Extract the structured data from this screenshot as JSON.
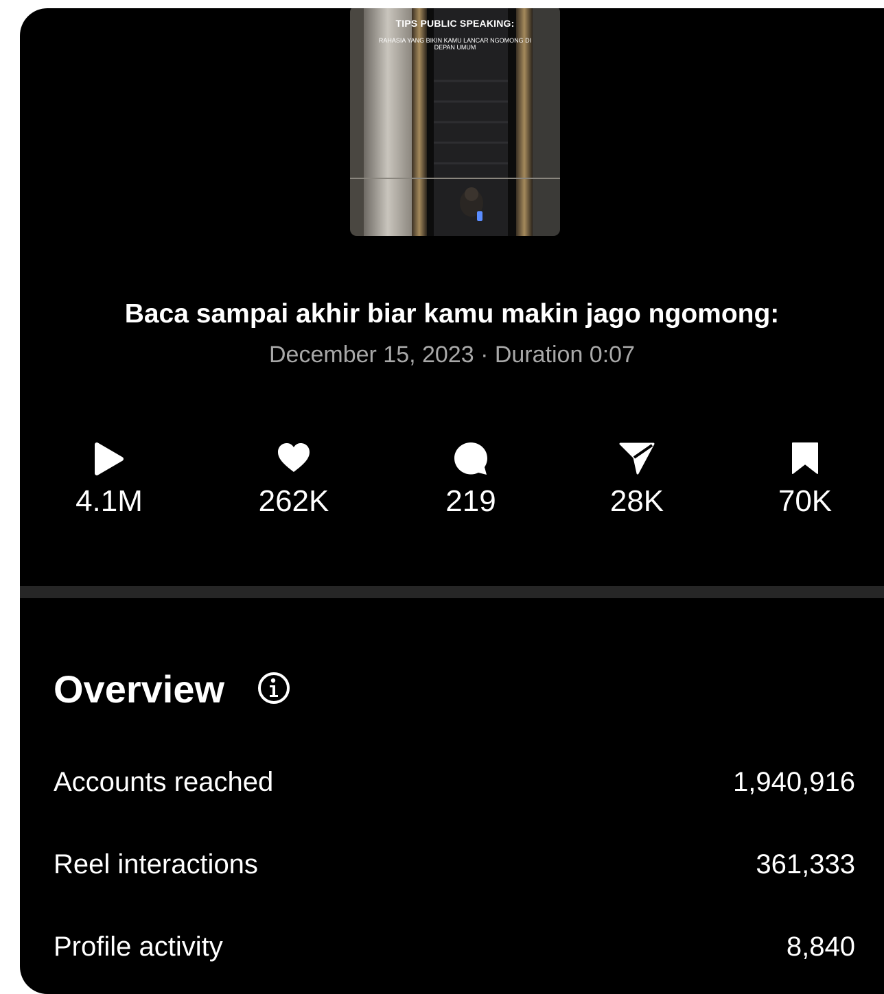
{
  "reel": {
    "thumbnail": {
      "title": "TIPS PUBLIC SPEAKING:",
      "subtitle": "RAHASIA YANG BIKIN KAMU LANCAR NGOMONG DI DEPAN UMUM"
    },
    "caption": "Baca sampai akhir biar kamu makin jago ngomong:",
    "meta": "December 15, 2023 · Duration 0:07"
  },
  "stats": [
    {
      "icon": "play-icon",
      "value": "4.1M"
    },
    {
      "icon": "heart-icon",
      "value": "262K"
    },
    {
      "icon": "comment-icon",
      "value": "219"
    },
    {
      "icon": "share-icon",
      "value": "28K"
    },
    {
      "icon": "bookmark-icon",
      "value": "70K"
    }
  ],
  "overview": {
    "title": "Overview",
    "info_icon": "info-icon",
    "rows": [
      {
        "label": "Accounts reached",
        "value": "1,940,916"
      },
      {
        "label": "Reel interactions",
        "value": "361,333"
      },
      {
        "label": "Profile activity",
        "value": "8,840"
      }
    ]
  },
  "colors": {
    "background": "#000000",
    "text": "#ffffff",
    "muted": "#a8a8a8",
    "divider": "#262626"
  }
}
